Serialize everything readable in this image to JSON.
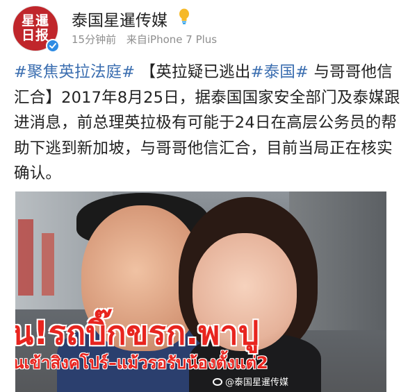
{
  "header": {
    "avatar_text": "星暹\n日报",
    "username": "泰国星暹传媒",
    "time": "15分钟前",
    "source": "来自iPhone 7 Plus"
  },
  "post": {
    "segments": [
      {
        "text": "#聚焦英拉法庭#",
        "type": "tag"
      },
      {
        "text": "  【英拉疑已逃出",
        "type": "text"
      },
      {
        "text": "#泰国#",
        "type": "tag"
      },
      {
        "text": "  与哥哥他信汇合】2017年8月25日，据泰国国家安全部门及泰媒跟进消息，前总理英拉极有可能于24日在高层公务员的帮助下逃到新加坡，与哥哥他信汇合，目前当局正在核实确认。",
        "type": "text"
      }
    ]
  },
  "image": {
    "thai_line1": "น!รถบิ๊กขรก.พาปู",
    "thai_line2": "นเข้าสิงคโปร์–แม้วรอรับน้องตั้งแต่2",
    "watermark": "@泰国星暹传媒"
  },
  "colors": {
    "tag": "#3b6eb0",
    "verified": "#2f8ce4",
    "avatar_bg": "#c0262b",
    "thai_text": "#e8251f"
  }
}
